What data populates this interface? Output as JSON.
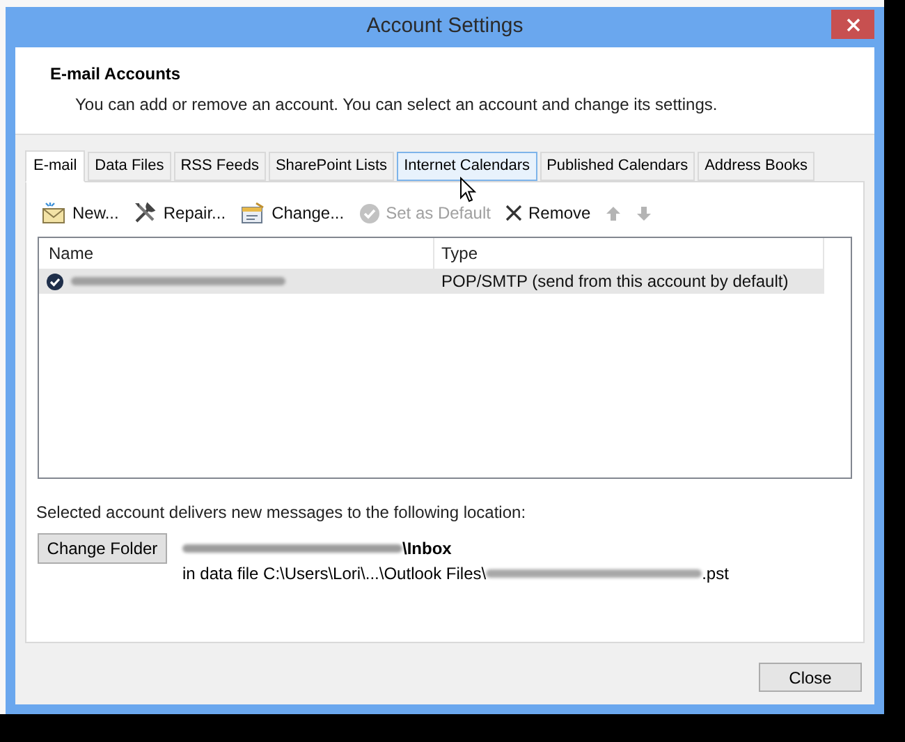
{
  "window": {
    "title": "Account Settings"
  },
  "header": {
    "title": "E-mail Accounts",
    "description": "You can add or remove an account. You can select an account and change its settings."
  },
  "tabs": [
    {
      "label": "E-mail",
      "selected": true,
      "hovered": false
    },
    {
      "label": "Data Files",
      "selected": false,
      "hovered": false
    },
    {
      "label": "RSS Feeds",
      "selected": false,
      "hovered": false
    },
    {
      "label": "SharePoint Lists",
      "selected": false,
      "hovered": false
    },
    {
      "label": "Internet Calendars",
      "selected": false,
      "hovered": true
    },
    {
      "label": "Published Calendars",
      "selected": false,
      "hovered": false
    },
    {
      "label": "Address Books",
      "selected": false,
      "hovered": false
    }
  ],
  "toolbar": [
    {
      "kind": "new",
      "label": "New...",
      "disabled": false
    },
    {
      "kind": "repair",
      "label": "Repair...",
      "disabled": false
    },
    {
      "kind": "change",
      "label": "Change...",
      "disabled": false
    },
    {
      "kind": "default",
      "label": "Set as Default",
      "disabled": true
    },
    {
      "kind": "remove",
      "label": "Remove",
      "disabled": false
    },
    {
      "kind": "up",
      "disabled": true
    },
    {
      "kind": "down",
      "disabled": true
    }
  ],
  "table": {
    "columns": [
      "Name",
      "Type"
    ],
    "rows": [
      {
        "default": true,
        "selected": true,
        "type": "POP/SMTP (send from this account by default)"
      }
    ]
  },
  "delivery": {
    "caption": "Selected account delivers new messages to the following location:",
    "button": "Change Folder",
    "folder": "\\Inbox",
    "data_file_prefix": "in data file C:\\Users\\Lori\\...\\Outlook Files\\",
    "data_file_suffix": ".pst"
  },
  "buttons": [
    {
      "label": "Close"
    }
  ]
}
